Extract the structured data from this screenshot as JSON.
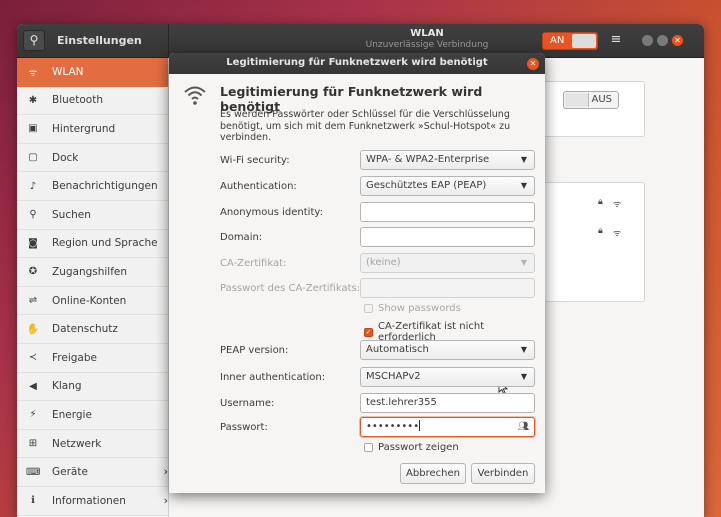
{
  "headerbar": {
    "title": "Einstellungen",
    "panel_title": "WLAN",
    "panel_subtitle": "Unzuverlässige Verbindung",
    "wifi_toggle_label": "AN",
    "search_icon": "search-icon",
    "menu_icon": "hamburger-icon"
  },
  "sidebar": {
    "items": [
      {
        "label": "WLAN",
        "icon": "wifi-icon",
        "glyph": "ᯤ"
      },
      {
        "label": "Bluetooth",
        "icon": "bluetooth-icon",
        "glyph": "✱"
      },
      {
        "label": "Hintergrund",
        "icon": "background-icon",
        "glyph": "▣"
      },
      {
        "label": "Dock",
        "icon": "dock-icon",
        "glyph": "▢"
      },
      {
        "label": "Benachrichtigungen",
        "icon": "bell-icon",
        "glyph": "♪"
      },
      {
        "label": "Suchen",
        "icon": "search-icon",
        "glyph": "⚲"
      },
      {
        "label": "Region und Sprache",
        "icon": "flag-icon",
        "glyph": "◙"
      },
      {
        "label": "Zugangshilfen",
        "icon": "accessibility-icon",
        "glyph": "✪"
      },
      {
        "label": "Online-Konten",
        "icon": "online-accounts-icon",
        "glyph": "⇌"
      },
      {
        "label": "Datenschutz",
        "icon": "privacy-hand-icon",
        "glyph": "✋"
      },
      {
        "label": "Freigabe",
        "icon": "share-icon",
        "glyph": "≺"
      },
      {
        "label": "Klang",
        "icon": "speaker-icon",
        "glyph": "◀"
      },
      {
        "label": "Energie",
        "icon": "power-icon",
        "glyph": "⚡"
      },
      {
        "label": "Netzwerk",
        "icon": "network-icon",
        "glyph": "⊞"
      },
      {
        "label": "Geräte",
        "icon": "devices-icon",
        "glyph": "⌨"
      },
      {
        "label": "Informationen",
        "icon": "info-icon",
        "glyph": "ℹ"
      }
    ]
  },
  "content": {
    "wifi_off_toggle_label": "AUS"
  },
  "dialog": {
    "title": "Legitimierung für Funknetzwerk wird benötigt",
    "heading": "Legitimierung für Funknetzwerk wird benötigt",
    "description": "Es werden Passwörter oder Schlüssel für die Verschlüsselung benötigt, um sich mit dem Funknetzwerk »Schul-Hotspot« zu verbinden.",
    "fields": {
      "wifi_security": {
        "label": "Wi-Fi security:",
        "value": "WPA- & WPA2-Enterprise"
      },
      "authentication": {
        "label": "Authentication:",
        "value": "Geschütztes EAP (PEAP)"
      },
      "anonymous_identity": {
        "label": "Anonymous identity:",
        "value": ""
      },
      "domain": {
        "label": "Domain:",
        "value": ""
      },
      "ca_cert": {
        "label": "CA-Zertifikat:",
        "value": "(keine)"
      },
      "ca_cert_password": {
        "label": "Passwort des CA-Zertifikats:",
        "value": ""
      },
      "peap_version": {
        "label": "PEAP version:",
        "value": "Automatisch"
      },
      "inner_auth": {
        "label": "Inner authentication:",
        "value": "MSCHAPv2"
      },
      "username": {
        "label": "Username:",
        "value": "test.lehrer355"
      },
      "password": {
        "label": "Passwort:",
        "value": "•••••••••"
      }
    },
    "checkboxes": {
      "show_passwords": {
        "label": "Show passwords",
        "checked": false,
        "disabled": true
      },
      "no_ca_required": {
        "label": "CA-Zertifikat ist nicht erforderlich",
        "checked": true
      },
      "show_password": {
        "label": "Passwort zeigen",
        "checked": false
      }
    },
    "buttons": {
      "cancel": "Abbrechen",
      "connect": "Verbinden"
    }
  },
  "colors": {
    "accent": "#e95420",
    "sidebar_active": "#e36d40",
    "headerbar": "#3a3a3a"
  }
}
